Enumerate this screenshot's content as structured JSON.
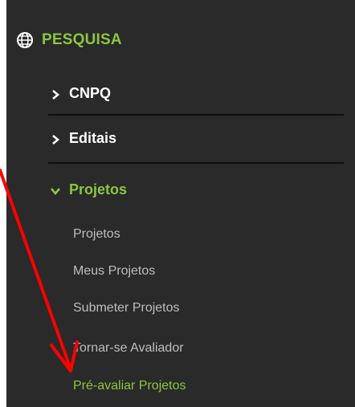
{
  "menu": {
    "section": {
      "label": "PESQUISA",
      "icon": "globe-icon"
    },
    "items": [
      {
        "label": "CNPQ",
        "icon": "chevron-right-icon",
        "expanded": false
      },
      {
        "label": "Editais",
        "icon": "chevron-right-icon",
        "expanded": false
      },
      {
        "label": "Projetos",
        "icon": "chevron-down-icon",
        "expanded": true
      }
    ],
    "subitems": [
      {
        "label": "Projetos"
      },
      {
        "label": "Meus Projetos"
      },
      {
        "label": "Submeter Projetos"
      },
      {
        "label": "Tornar-se Avaliador"
      },
      {
        "label": "Pré-avaliar Projetos",
        "highlighted": true
      }
    ]
  },
  "colors": {
    "background": "#2a2a2a",
    "accent": "#8cc63f",
    "text": "#ffffff",
    "subtext": "#bdbdbd",
    "annotation": "#ff0000"
  },
  "annotation": {
    "type": "arrow",
    "points_to": "Pré-avaliar Projetos"
  }
}
